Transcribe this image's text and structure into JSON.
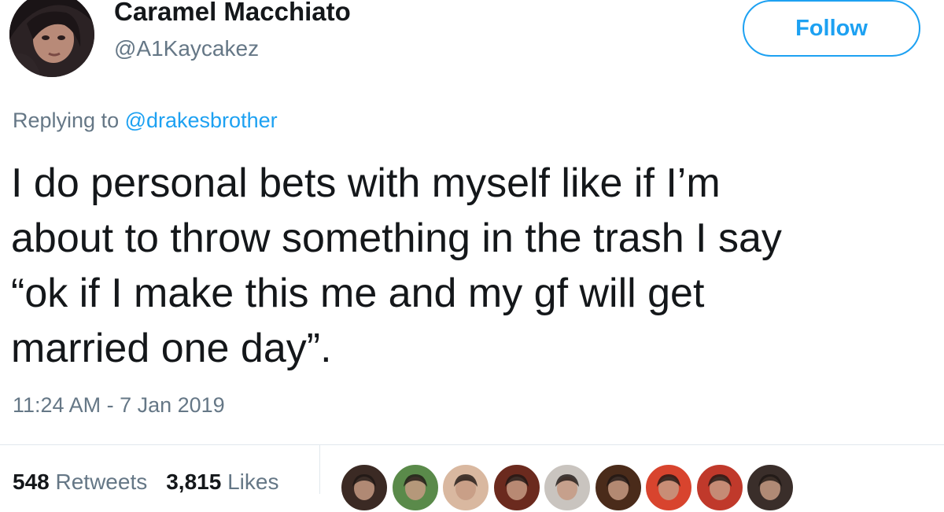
{
  "user": {
    "display_name": "Caramel Macchiato",
    "handle": "@A1Kaycakez",
    "avatar_icon": "profile-photo"
  },
  "follow_button": {
    "label": "Follow",
    "color": "#1da1f2"
  },
  "reply": {
    "prefix": "Replying to ",
    "target": "@drakesbrother"
  },
  "tweet": {
    "lines": [
      "I do personal bets with myself like if I’m",
      "about to throw something in the trash I say",
      "“ok if I make this me and my gf will get",
      "married one day”."
    ]
  },
  "timestamp": "11:24 AM - 7 Jan 2019",
  "stats": {
    "retweets_count": "548",
    "retweets_label": "Retweets",
    "likes_count": "3,815",
    "likes_label": "Likes"
  },
  "likers": [
    {
      "name": "liker-avatar-1",
      "color": "#3b2a24"
    },
    {
      "name": "liker-avatar-2",
      "color": "#5a8a4a"
    },
    {
      "name": "liker-avatar-3",
      "color": "#d9b8a0"
    },
    {
      "name": "liker-avatar-4",
      "color": "#6b2a1e"
    },
    {
      "name": "liker-avatar-5",
      "color": "#c9c4bf"
    },
    {
      "name": "liker-avatar-6",
      "color": "#4a2b1a"
    },
    {
      "name": "liker-avatar-7",
      "color": "#d8442e"
    },
    {
      "name": "liker-avatar-8",
      "color": "#c0392b"
    },
    {
      "name": "liker-avatar-9",
      "color": "#3a2e2a"
    }
  ],
  "colors": {
    "accent": "#1da1f2",
    "text_primary": "#14171a",
    "text_secondary": "#657786",
    "divider": "#e1e8ed"
  }
}
